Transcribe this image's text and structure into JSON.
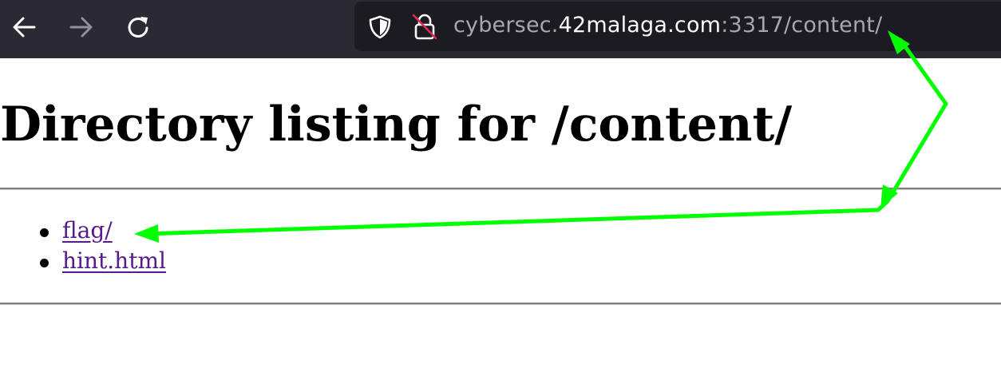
{
  "browser": {
    "icons": {
      "back": "arrow-left-icon",
      "forward": "arrow-right-icon",
      "reload": "reload-icon",
      "tracking_protection": "shield-icon",
      "insecure": "insecure-lock-icon"
    },
    "url": {
      "prefix": "cybersec.",
      "domain": "42malaga.com",
      "suffix": ":3317/content/"
    }
  },
  "page": {
    "title": "Directory listing for /content/",
    "entries": [
      {
        "label": "flag/"
      },
      {
        "label": "hint.html"
      }
    ]
  },
  "colors": {
    "toolbar_bg": "#2b2a33",
    "urlbar_bg": "#1c1b22",
    "visited_link": "#551a8b",
    "annotation_arrow": "#00ff00"
  }
}
